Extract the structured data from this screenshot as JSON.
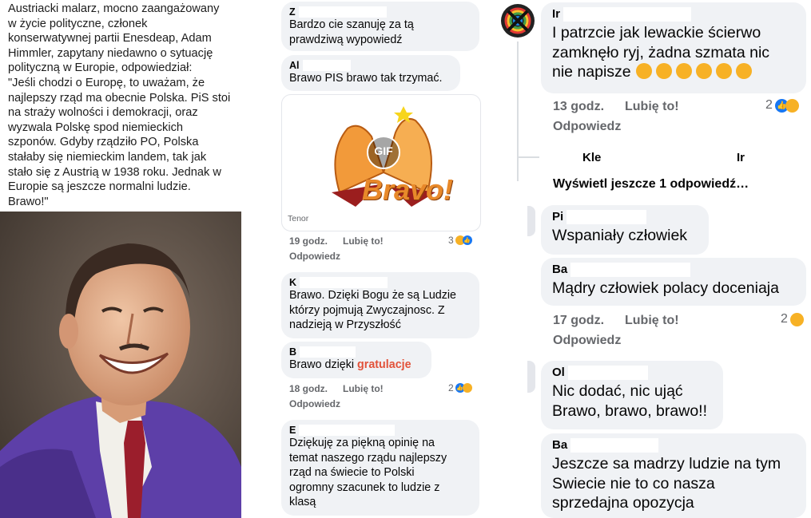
{
  "post": {
    "lines": [
      "Austriacki malarz, mocno zaangażowany",
      "w życie polityczne, członek",
      "konserwatywnej partii Enesdeap, Adam",
      "Himmler, zapytany niedawno o sytuację",
      "polityczną w Europie, odpowiedział:",
      "\"Jeśli chodzi o Europę, to uważam, że",
      "najlepszy rząd ma obecnie Polska. PiS stoi",
      "na straży wolności i demokracji, oraz",
      "wyzwala Polskę spod niemieckich",
      "szponów. Gdyby rządziło PO, Polska",
      "stałaby się niemieckim landem, tak jak",
      "stało się z Austrią w 1938 roku. Jednak w",
      "Europie są jeszcze normalni ludzie.",
      "Brawo!\""
    ]
  },
  "middle": {
    "c1": {
      "initial": "Z",
      "lines": [
        "Bardzo cie szanuję za tą",
        "prawdziwą wypowiedź"
      ]
    },
    "c2": {
      "initial": "Al",
      "lines": [
        "Brawo PIS brawo tak trzymać."
      ]
    },
    "gif": {
      "badge": "GIF",
      "caption": "Bravo!",
      "source": "Tenor"
    },
    "meta1": {
      "time": "19 godz.",
      "like": "Lubię to!",
      "count": "3",
      "reply": "Odpowiedz"
    },
    "c3": {
      "initial": "K",
      "lines": [
        "Brawo. Dzięki Bogu że są Ludzie",
        "którzy pojmują Zwyczajnosc. Z",
        "nadzieją w Przyszłość"
      ]
    },
    "c4": {
      "initial": "B",
      "text": "Brawo  dzięki",
      "highlight": "gratulacje"
    },
    "meta2": {
      "time": "18 godz.",
      "like": "Lubię to!",
      "count": "2",
      "reply": "Odpowiedz"
    },
    "c5": {
      "initial": "E",
      "lines": [
        "Dziękuję za piękną opinię na",
        "temat naszego rządu najlepszy",
        "rząd na świecie to Polski",
        "ogromny szacunek to ludzie z",
        "klasą"
      ]
    }
  },
  "right": {
    "c1": {
      "initial": "Ir",
      "lines": [
        "I patrzcie jak lewackie ścierwo",
        "zamknęło ryj, żadna szmata nic",
        "nie napisze"
      ]
    },
    "meta1": {
      "time": "13 godz.",
      "like": "Lubię to!",
      "count": "2",
      "reply": "Odpowiedz"
    },
    "reply_preview": {
      "name": "Kle",
      "tail": "Ir"
    },
    "more_replies": "Wyświetl jeszcze 1 odpowiedź…",
    "c2": {
      "initial": "Pi",
      "lines": [
        "Wspaniały człowiek"
      ]
    },
    "c3": {
      "initial": "Ba",
      "lines": [
        "Mądry człowiek polacy doceniaja"
      ]
    },
    "meta2": {
      "time": "17 godz.",
      "like": "Lubię to!",
      "count": "2",
      "reply": "Odpowiedz"
    },
    "c4": {
      "initial": "Ol",
      "lines": [
        "Nic dodać, nic ująć",
        "Brawo, brawo, brawo!!"
      ]
    },
    "c5": {
      "initial": "Ba",
      "lines": [
        "Jeszcze sa madrzy ludzie na tym",
        "Swiecie nie to co nasza",
        "sprzedajna opozycja"
      ]
    }
  },
  "colors": {
    "bubble": "#f0f2f5",
    "meta": "#65676b",
    "highlight": "#e2523a",
    "like_blue": "#1877f2",
    "laugh_yellow": "#f7b125"
  }
}
